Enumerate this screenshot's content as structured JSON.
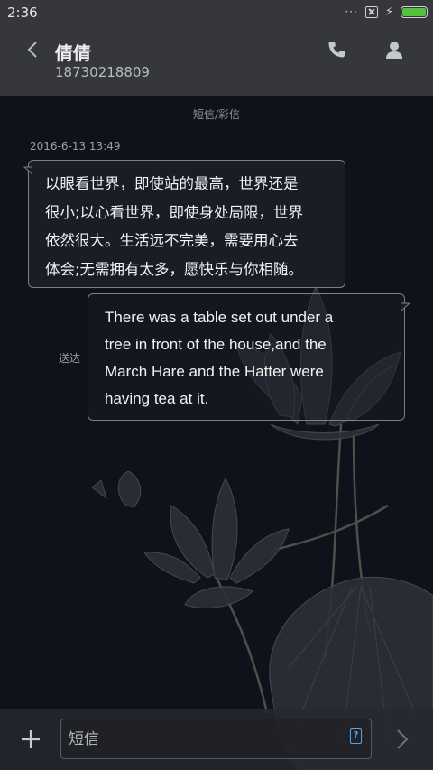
{
  "status_bar": {
    "time": "2:36",
    "more_dots": "···",
    "battery_level": 1.0,
    "battery_color": "#53c13a"
  },
  "header": {
    "contact_name": "倩倩",
    "contact_number": "18730218809",
    "icons": [
      "back-chevron-icon",
      "phone-icon",
      "profile-icon"
    ]
  },
  "conversation": {
    "message_type_label": "短信/彩信",
    "timestamp": "2016-6-13 13:49",
    "incoming_message": {
      "lines": [
        "以眼看世界，即使站的最高，世界还是",
        "很小;以心看世界，即使身处局限，世界",
        "依然很大。生活远不完美，需要用心去",
        "体会;无需拥有太多，愿快乐与你相随。"
      ]
    },
    "outgoing_message": {
      "lines": [
        "There was a table set out under a",
        "tree in front of the house,and the",
        "March Hare and the Hatter were",
        "having tea at it."
      ],
      "status": "送达"
    }
  },
  "composer": {
    "placeholder": "短信",
    "value": "",
    "sim_badge": "?",
    "icons": [
      "add-icon",
      "sim-card-icon",
      "send-icon"
    ]
  },
  "theme": {
    "background": "#0f121b",
    "bar": "#35373c",
    "bubble_border": "#7d8088",
    "accent": "#5aa2e0"
  }
}
